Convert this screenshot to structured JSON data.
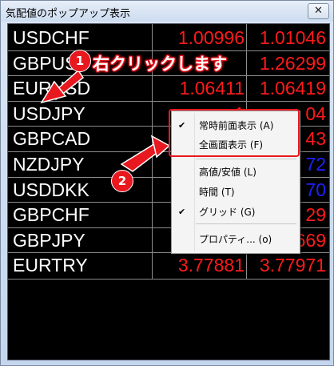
{
  "window": {
    "title": "気配値のポップアップ表示",
    "close_symbol": "✕"
  },
  "quotes": [
    {
      "symbol": "USDCHF",
      "bid": "1.00996",
      "ask": "1.01046",
      "bid_color": "#ff1a1a",
      "ask_color": "#ff1a1a"
    },
    {
      "symbol": "GBPUSD",
      "bid": "",
      "ask": "1.26299",
      "bid_color": "#ff1a1a",
      "ask_color": "#ff1a1a"
    },
    {
      "symbol": "EURUSD",
      "bid": "1.06411",
      "ask": "1.06419",
      "bid_color": "#ff1a1a",
      "ask_color": "#ff1a1a"
    },
    {
      "symbol": "USDJPY",
      "bid": "1",
      "ask": "04",
      "bid_color": "#ff1a1a",
      "ask_color": "#ff1a1a"
    },
    {
      "symbol": "GBPCAD",
      "bid": "",
      "ask": "43",
      "bid_color": "#ff1a1a",
      "ask_color": "#ff1a1a"
    },
    {
      "symbol": "NZDJPY",
      "bid": "8",
      "ask": "72",
      "bid_color": "#2020ff",
      "ask_color": "#2020ff"
    },
    {
      "symbol": "USDDKK",
      "bid": "6.",
      "ask": "70",
      "bid_color": "#2020ff",
      "ask_color": "#2020ff"
    },
    {
      "symbol": "GBPCHF",
      "bid": "1.",
      "ask": "29",
      "bid_color": "#ff1a1a",
      "ask_color": "#ff1a1a"
    },
    {
      "symbol": "GBPJPY",
      "bid": "14",
      "ask": "669",
      "bid_color": "#ff1a1a",
      "ask_color": "#ff1a1a"
    },
    {
      "symbol": "EURTRY",
      "bid": "3.77881",
      "ask": "3.77971",
      "bid_color": "#ff1a1a",
      "ask_color": "#ff1a1a"
    }
  ],
  "annotations": {
    "step1_number": "1",
    "step2_number": "2",
    "callout_text": "右クリックします"
  },
  "context_menu": {
    "items": [
      {
        "label": "常時前面表示 (A)",
        "checked": true
      },
      {
        "label": "全画面表示 (F)",
        "checked": false
      },
      {
        "label": "高値/安値 (L)",
        "checked": false
      },
      {
        "label": "時間 (T)",
        "checked": false
      },
      {
        "label": "グリッド (G)",
        "checked": true
      },
      {
        "label": "プロパティ... (o)",
        "checked": false
      }
    ],
    "check_symbol": "✔"
  }
}
